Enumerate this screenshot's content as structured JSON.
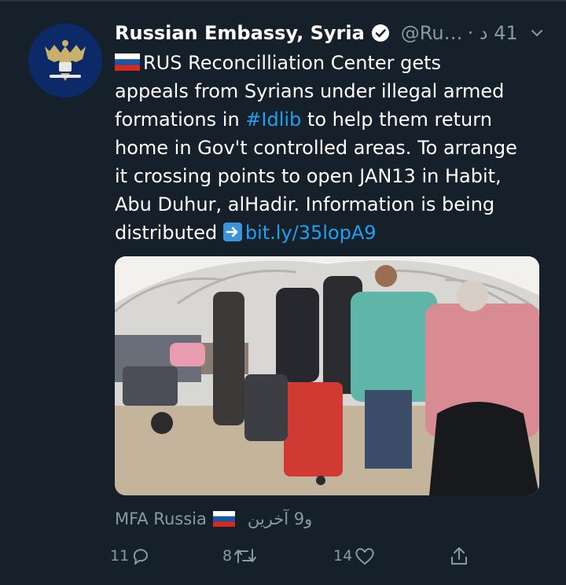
{
  "tweet": {
    "author_name": "Russian Embassy, Syria",
    "handle": "@Ru…",
    "time": "41 د ·",
    "text_lines": [
      "RUS Reconcilliation Center gets",
      "appeals from Syrians under illegal armed",
      "formations in ",
      "home in Gov't controlled areas. To arrange",
      "it crossing points to open JAN13 in Habit,",
      "Abu Duhur, alHadir. Information is being",
      "distributed "
    ],
    "hashtag": "#Idlib",
    "line3_suffix": " to help them return",
    "link": "bit.ly/35lopA9"
  },
  "footer": {
    "liked_by": "MFA Russia",
    "others": "و9 آخرين"
  },
  "actions": {
    "replies": "11",
    "retweets": "8",
    "likes": "14"
  },
  "colors": {
    "background": "#15202b",
    "link": "#1da1f2",
    "muted": "#8899a6"
  },
  "icons": [
    "verified-badge-icon",
    "chevron-down-icon",
    "russia-flag-icon",
    "arrow-right-icon",
    "reply-icon",
    "retweet-icon",
    "like-icon",
    "share-icon"
  ]
}
